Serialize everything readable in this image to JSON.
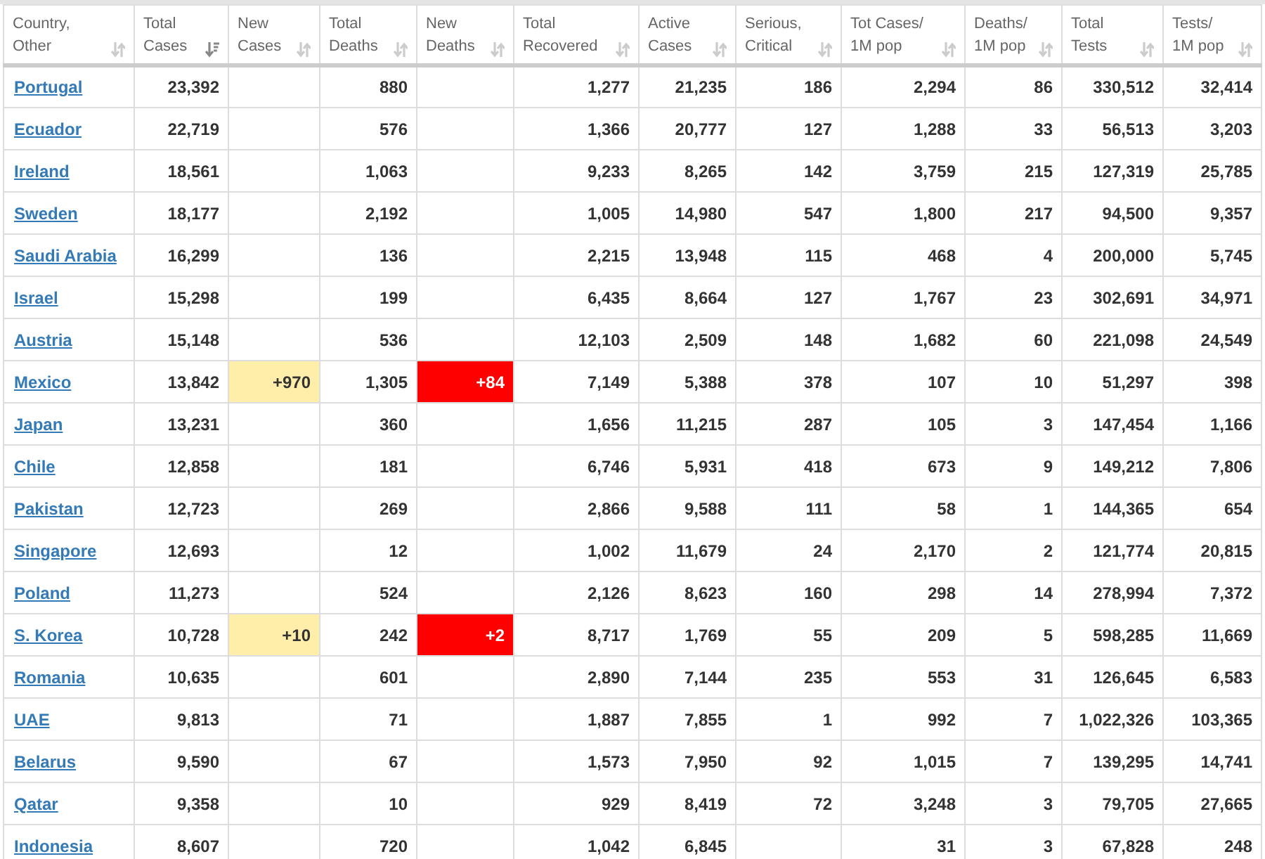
{
  "table": {
    "columns": [
      {
        "label": "Country,\nOther",
        "sorted": false
      },
      {
        "label": "Total\nCases",
        "sorted": true
      },
      {
        "label": "New\nCases",
        "sorted": false
      },
      {
        "label": "Total\nDeaths",
        "sorted": false
      },
      {
        "label": "New\nDeaths",
        "sorted": false
      },
      {
        "label": "Total\nRecovered",
        "sorted": false
      },
      {
        "label": "Active\nCases",
        "sorted": false
      },
      {
        "label": "Serious,\nCritical",
        "sorted": false
      },
      {
        "label": "Tot Cases/\n1M pop",
        "sorted": false
      },
      {
        "label": "Deaths/\n1M pop",
        "sorted": false
      },
      {
        "label": "Total\nTests",
        "sorted": false
      },
      {
        "label": "Tests/\n1M pop",
        "sorted": false
      }
    ],
    "rows": [
      {
        "country": "Portugal",
        "total_cases": "23,392",
        "total_deaths": "880",
        "total_recovered": "1,277",
        "active_cases": "21,235",
        "serious_critical": "186",
        "cases_per_1m": "2,294",
        "deaths_per_1m": "86",
        "total_tests": "330,512",
        "tests_per_1m": "32,414"
      },
      {
        "country": "Ecuador",
        "total_cases": "22,719",
        "total_deaths": "576",
        "total_recovered": "1,366",
        "active_cases": "20,777",
        "serious_critical": "127",
        "cases_per_1m": "1,288",
        "deaths_per_1m": "33",
        "total_tests": "56,513",
        "tests_per_1m": "3,203"
      },
      {
        "country": "Ireland",
        "total_cases": "18,561",
        "total_deaths": "1,063",
        "total_recovered": "9,233",
        "active_cases": "8,265",
        "serious_critical": "142",
        "cases_per_1m": "3,759",
        "deaths_per_1m": "215",
        "total_tests": "127,319",
        "tests_per_1m": "25,785"
      },
      {
        "country": "Sweden",
        "total_cases": "18,177",
        "total_deaths": "2,192",
        "total_recovered": "1,005",
        "active_cases": "14,980",
        "serious_critical": "547",
        "cases_per_1m": "1,800",
        "deaths_per_1m": "217",
        "total_tests": "94,500",
        "tests_per_1m": "9,357"
      },
      {
        "country": "Saudi Arabia",
        "total_cases": "16,299",
        "total_deaths": "136",
        "total_recovered": "2,215",
        "active_cases": "13,948",
        "serious_critical": "115",
        "cases_per_1m": "468",
        "deaths_per_1m": "4",
        "total_tests": "200,000",
        "tests_per_1m": "5,745"
      },
      {
        "country": "Israel",
        "total_cases": "15,298",
        "total_deaths": "199",
        "total_recovered": "6,435",
        "active_cases": "8,664",
        "serious_critical": "127",
        "cases_per_1m": "1,767",
        "deaths_per_1m": "23",
        "total_tests": "302,691",
        "tests_per_1m": "34,971"
      },
      {
        "country": "Austria",
        "total_cases": "15,148",
        "total_deaths": "536",
        "total_recovered": "12,103",
        "active_cases": "2,509",
        "serious_critical": "148",
        "cases_per_1m": "1,682",
        "deaths_per_1m": "60",
        "total_tests": "221,098",
        "tests_per_1m": "24,549"
      },
      {
        "country": "Mexico",
        "total_cases": "13,842",
        "new_cases": "+970",
        "total_deaths": "1,305",
        "new_deaths": "+84",
        "total_recovered": "7,149",
        "active_cases": "5,388",
        "serious_critical": "378",
        "cases_per_1m": "107",
        "deaths_per_1m": "10",
        "total_tests": "51,297",
        "tests_per_1m": "398"
      },
      {
        "country": "Japan",
        "total_cases": "13,231",
        "total_deaths": "360",
        "total_recovered": "1,656",
        "active_cases": "11,215",
        "serious_critical": "287",
        "cases_per_1m": "105",
        "deaths_per_1m": "3",
        "total_tests": "147,454",
        "tests_per_1m": "1,166"
      },
      {
        "country": "Chile",
        "total_cases": "12,858",
        "total_deaths": "181",
        "total_recovered": "6,746",
        "active_cases": "5,931",
        "serious_critical": "418",
        "cases_per_1m": "673",
        "deaths_per_1m": "9",
        "total_tests": "149,212",
        "tests_per_1m": "7,806"
      },
      {
        "country": "Pakistan",
        "total_cases": "12,723",
        "total_deaths": "269",
        "total_recovered": "2,866",
        "active_cases": "9,588",
        "serious_critical": "111",
        "cases_per_1m": "58",
        "deaths_per_1m": "1",
        "total_tests": "144,365",
        "tests_per_1m": "654"
      },
      {
        "country": "Singapore",
        "total_cases": "12,693",
        "total_deaths": "12",
        "total_recovered": "1,002",
        "active_cases": "11,679",
        "serious_critical": "24",
        "cases_per_1m": "2,170",
        "deaths_per_1m": "2",
        "total_tests": "121,774",
        "tests_per_1m": "20,815"
      },
      {
        "country": "Poland",
        "total_cases": "11,273",
        "total_deaths": "524",
        "total_recovered": "2,126",
        "active_cases": "8,623",
        "serious_critical": "160",
        "cases_per_1m": "298",
        "deaths_per_1m": "14",
        "total_tests": "278,994",
        "tests_per_1m": "7,372"
      },
      {
        "country": "S. Korea",
        "total_cases": "10,728",
        "new_cases": "+10",
        "total_deaths": "242",
        "new_deaths": "+2",
        "total_recovered": "8,717",
        "active_cases": "1,769",
        "serious_critical": "55",
        "cases_per_1m": "209",
        "deaths_per_1m": "5",
        "total_tests": "598,285",
        "tests_per_1m": "11,669"
      },
      {
        "country": "Romania",
        "total_cases": "10,635",
        "total_deaths": "601",
        "total_recovered": "2,890",
        "active_cases": "7,144",
        "serious_critical": "235",
        "cases_per_1m": "553",
        "deaths_per_1m": "31",
        "total_tests": "126,645",
        "tests_per_1m": "6,583"
      },
      {
        "country": "UAE",
        "total_cases": "9,813",
        "total_deaths": "71",
        "total_recovered": "1,887",
        "active_cases": "7,855",
        "serious_critical": "1",
        "cases_per_1m": "992",
        "deaths_per_1m": "7",
        "total_tests": "1,022,326",
        "tests_per_1m": "103,365"
      },
      {
        "country": "Belarus",
        "total_cases": "9,590",
        "total_deaths": "67",
        "total_recovered": "1,573",
        "active_cases": "7,950",
        "serious_critical": "92",
        "cases_per_1m": "1,015",
        "deaths_per_1m": "7",
        "total_tests": "139,295",
        "tests_per_1m": "14,741"
      },
      {
        "country": "Qatar",
        "total_cases": "9,358",
        "total_deaths": "10",
        "total_recovered": "929",
        "active_cases": "8,419",
        "serious_critical": "72",
        "cases_per_1m": "3,248",
        "deaths_per_1m": "3",
        "total_tests": "79,705",
        "tests_per_1m": "27,665"
      },
      {
        "country": "Indonesia",
        "total_cases": "8,607",
        "total_deaths": "720",
        "total_recovered": "1,042",
        "active_cases": "6,845",
        "cases_per_1m": "31",
        "deaths_per_1m": "3",
        "total_tests": "67,828",
        "tests_per_1m": "248"
      }
    ]
  }
}
